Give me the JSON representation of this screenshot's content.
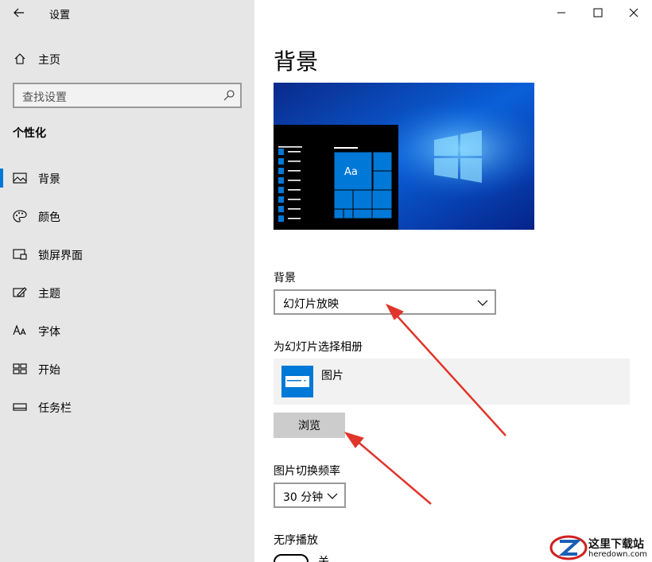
{
  "window": {
    "title": "设置"
  },
  "sidebar": {
    "home_label": "主页",
    "search_placeholder": "查找设置",
    "section_title": "个性化",
    "items": [
      {
        "label": "背景",
        "icon": "image-icon",
        "active": true
      },
      {
        "label": "颜色",
        "icon": "palette-icon",
        "active": false
      },
      {
        "label": "锁屏界面",
        "icon": "lock-screen-icon",
        "active": false
      },
      {
        "label": "主题",
        "icon": "theme-icon",
        "active": false
      },
      {
        "label": "字体",
        "icon": "font-icon",
        "active": false
      },
      {
        "label": "开始",
        "icon": "start-icon",
        "active": false
      },
      {
        "label": "任务栏",
        "icon": "taskbar-icon",
        "active": false
      }
    ]
  },
  "main": {
    "page_title": "背景",
    "preview": {
      "tile_text": "Aa"
    },
    "background_label": "背景",
    "background_value": "幻灯片放映",
    "album_label": "为幻灯片选择相册",
    "album_name": "图片",
    "browse_label": "浏览",
    "interval_label": "图片切换频率",
    "interval_value": "30 分钟",
    "shuffle_label": "无序播放",
    "shuffle_state": "关"
  },
  "watermark": {
    "text": "这里下载站",
    "domain": "heredown.com"
  },
  "colors": {
    "accent": "#0078d7",
    "sidebar_bg": "#e6e6e6",
    "arrow": "#e0352b"
  }
}
